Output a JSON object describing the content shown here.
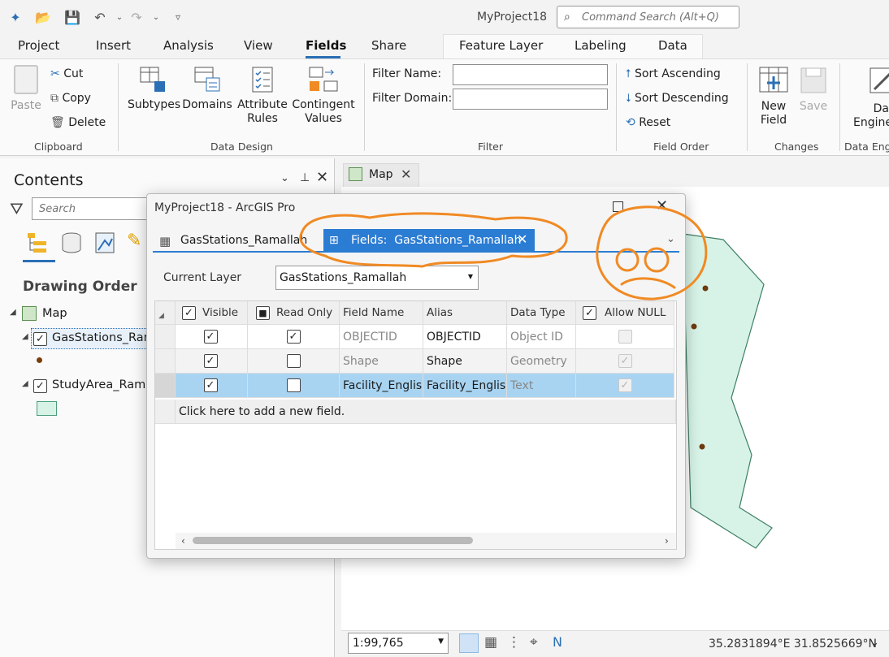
{
  "app": {
    "title": "MyProject18",
    "search_placeholder": "Command Search (Alt+Q)"
  },
  "tabs": {
    "project": "Project",
    "insert": "Insert",
    "analysis": "Analysis",
    "view": "View",
    "fields": "Fields",
    "share": "Share",
    "feature_layer": "Feature Layer",
    "labeling": "Labeling",
    "data": "Data"
  },
  "ribbon": {
    "clipboard": {
      "label": "Clipboard",
      "paste": "Paste",
      "cut": "Cut",
      "copy": "Copy",
      "delete": "Delete"
    },
    "data_design": {
      "label": "Data Design",
      "subtypes": "Subtypes",
      "domains": "Domains",
      "attribute_rules_1": "Attribute",
      "attribute_rules_2": "Rules",
      "contingent_values_1": "Contingent",
      "contingent_values_2": "Values"
    },
    "filter": {
      "label": "Filter",
      "filter_name": "Filter Name:",
      "filter_domain": "Filter Domain:"
    },
    "field_order": {
      "label": "Field Order",
      "sort_ascending": "Sort Ascending",
      "sort_descending": "Sort Descending",
      "reset": "Reset"
    },
    "changes": {
      "label": "Changes",
      "new_field_1": "New",
      "new_field_2": "Field",
      "save": "Save"
    },
    "data_engineering": {
      "label": "Data Eng",
      "btn_1": "Da",
      "btn_2": "Engine"
    }
  },
  "contents": {
    "title": "Contents",
    "search_placeholder": "Search",
    "drawing_order": "Drawing Order",
    "map": "Map",
    "layer1": "GasStations_Rama",
    "layer2": "StudyArea_Ramal"
  },
  "map_tab": {
    "label": "Map"
  },
  "status": {
    "scale": "1:99,765",
    "coords": "35.2831894°E 31.8525669°N"
  },
  "dialog": {
    "title": "MyProject18 - ArcGIS Pro",
    "tab1": "GasStations_Ramallah",
    "tab2": "Fields:  GasStations_Ramallah",
    "current_layer_label": "Current Layer",
    "current_layer_value": "GasStations_Ramallah",
    "columns": {
      "visible": "Visible",
      "read_only": "Read Only",
      "field_name": "Field Name",
      "alias": "Alias",
      "data_type": "Data Type",
      "allow_null": "Allow NULL"
    },
    "rows": [
      {
        "visible": true,
        "read_only": true,
        "field_name": "OBJECTID",
        "alias": "OBJECTID",
        "data_type": "Object ID",
        "allow_null": false
      },
      {
        "visible": true,
        "read_only": false,
        "field_name": "Shape",
        "alias": "Shape",
        "data_type": "Geometry",
        "allow_null": true
      },
      {
        "visible": true,
        "read_only": false,
        "field_name": "Facility_English",
        "alias": "Facility_English",
        "data_type": "Text",
        "allow_null": true
      }
    ],
    "add_field": "Click here to add a new field."
  },
  "colors": {
    "accent": "#2b6fb5",
    "selected_row": "#a8d4f2",
    "annotation": "#f08a24",
    "study_area": "#d7f3e7"
  }
}
